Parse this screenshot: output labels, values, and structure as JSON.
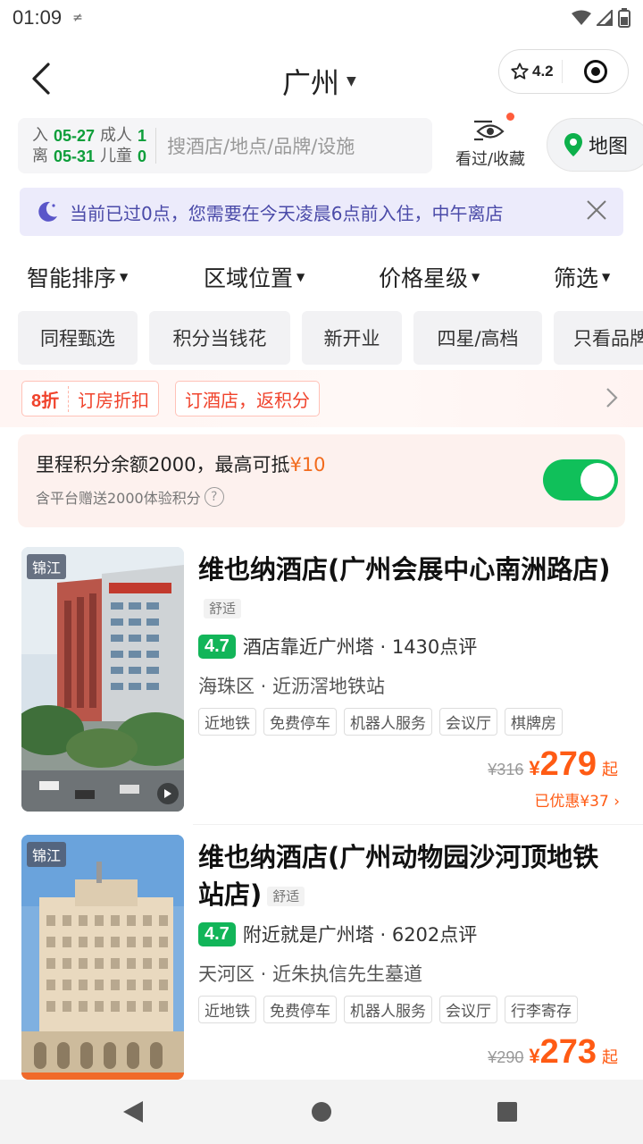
{
  "status_bar": {
    "time": "01:09",
    "extra": "≠"
  },
  "header": {
    "city": "广州",
    "rating": "4.2"
  },
  "search": {
    "checkin_label": "入",
    "checkin_date": "05-27",
    "checkout_label": "离",
    "checkout_date": "05-31",
    "adult_label": "成人",
    "adult_count": "1",
    "child_label": "儿童",
    "child_count": "0",
    "placeholder": "搜酒店/地点/品牌/设施",
    "seen_label": "看过/收藏",
    "map_label": "地图"
  },
  "notice": {
    "text": "当前已过0点，您需要在今天凌晨6点前入住，中午离店"
  },
  "filters": [
    "智能排序",
    "区域位置",
    "价格星级",
    "筛选"
  ],
  "chips": [
    "同程甄选",
    "积分当钱花",
    "新开业",
    "四星/高档",
    "只看品牌"
  ],
  "promo": {
    "discount_strong": "8折",
    "discount_text": "订房折扣",
    "points_text": "订酒店，返积分"
  },
  "points": {
    "line1_prefix": "里程积分余额2000，最高可抵",
    "line1_amount": "¥10",
    "line2": "含平台赠送2000体验积分",
    "toggle_on": true
  },
  "hotels": [
    {
      "brand": "锦江",
      "name": "维也纳酒店(广州会展中心南洲路店)",
      "level": "舒适",
      "score": "4.7",
      "highlight": "酒店靠近广州塔 · 1430点评",
      "location": "海珠区 · 近沥滘地铁站",
      "amenities": [
        "近地铁",
        "免费停车",
        "机器人服务",
        "会议厅",
        "棋牌房"
      ],
      "original_price": "¥316",
      "price": "279",
      "price_suffix": "起",
      "discount": "已优惠¥37"
    },
    {
      "brand": "锦江",
      "name": "维也纳酒店(广州动物园沙河顶地铁站店)",
      "level": "舒适",
      "score": "4.7",
      "highlight": "附近就是广州塔 · 6202点评",
      "location": "天河区 · 近朱执信先生墓道",
      "amenities": [
        "近地铁",
        "免费停车",
        "机器人服务",
        "会议厅",
        "行李寄存"
      ],
      "original_price": "¥290",
      "price": "273",
      "price_suffix": "起"
    }
  ],
  "colors": {
    "accent_green": "#12b559",
    "price_orange": "#ff5b14",
    "notice_text": "#4a4aa8"
  }
}
